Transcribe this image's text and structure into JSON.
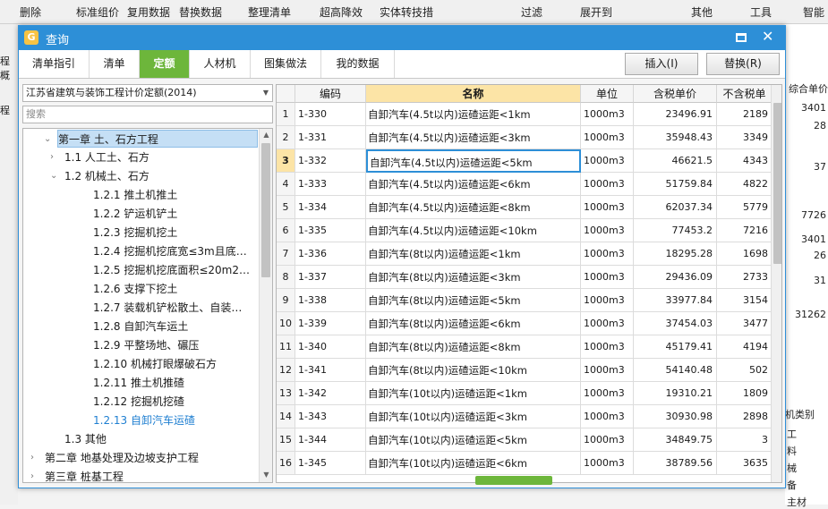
{
  "background_app": {
    "toolbar": [
      "删除",
      "标准组价",
      "复用数据",
      "替换数据",
      "整理清单",
      "超高降效",
      "实体转技措",
      "过滤",
      "展开到",
      "其他",
      "工具",
      "智能"
    ],
    "left_labels": [
      "程概",
      "程"
    ],
    "right_header": "综合单价",
    "right_values": [
      "3401",
      "28",
      "37",
      "7726",
      "3401",
      "26",
      "31",
      "31262"
    ],
    "right_category_header": "机类别",
    "right_categories": [
      "工",
      "料",
      "械",
      "备",
      "主材"
    ]
  },
  "dialog": {
    "title": "查询",
    "tabs": [
      "清单指引",
      "清单",
      "定额",
      "人材机",
      "图集做法",
      "我的数据"
    ],
    "active_tab": "定额",
    "insert_button": "插入(I)",
    "replace_button": "替换(R)"
  },
  "left_panel": {
    "quota_library": "江苏省建筑与装饰工程计价定额(2014)",
    "search_placeholder": "搜索",
    "tree": [
      {
        "label": "第一章 土、石方工程",
        "level": 0,
        "arrow": "down",
        "selected": true
      },
      {
        "label": "1.1 人工土、石方",
        "level": 1,
        "arrow": "right"
      },
      {
        "label": "1.2 机械土、石方",
        "level": 1,
        "arrow": "down"
      },
      {
        "label": "1.2.1 推土机推土",
        "level": 2
      },
      {
        "label": "1.2.2 铲运机铲土",
        "level": 2
      },
      {
        "label": "1.2.3 挖掘机挖土",
        "level": 2
      },
      {
        "label": "1.2.4 挖掘机挖底宽≤3m且底…",
        "level": 2
      },
      {
        "label": "1.2.5 挖掘机挖底面积≤20m2…",
        "level": 2
      },
      {
        "label": "1.2.6 支撑下挖土",
        "level": 2
      },
      {
        "label": "1.2.7 装载机铲松散土、自装…",
        "level": 2
      },
      {
        "label": "1.2.8 自卸汽车运土",
        "level": 2
      },
      {
        "label": "1.2.9 平整场地、碾压",
        "level": 2
      },
      {
        "label": "1.2.10 机械打眼爆破石方",
        "level": 2
      },
      {
        "label": "1.2.11 推土机推碴",
        "level": 2
      },
      {
        "label": "1.2.12 挖掘机挖碴",
        "level": 2
      },
      {
        "label": "1.2.13 自卸汽车运碴",
        "level": 2,
        "current": true
      },
      {
        "label": "1.3 其他",
        "level": 1
      },
      {
        "label": "第二章 地基处理及边坡支护工程",
        "level": 0,
        "arrow": "right"
      },
      {
        "label": "第三章 桩基工程",
        "level": 0,
        "arrow": "right"
      }
    ]
  },
  "grid": {
    "columns": [
      "编码",
      "名称",
      "单位",
      "含税单价",
      "不含税单"
    ],
    "selected_row": 3,
    "rows": [
      {
        "n": "1",
        "code": "1-330",
        "name": "自卸汽车(4.5t以内)运碴运距<1km",
        "unit": "1000m3",
        "tax": "23496.91",
        "notax": "2189"
      },
      {
        "n": "2",
        "code": "1-331",
        "name": "自卸汽车(4.5t以内)运碴运距<3km",
        "unit": "1000m3",
        "tax": "35948.43",
        "notax": "3349"
      },
      {
        "n": "3",
        "code": "1-332",
        "name": "自卸汽车(4.5t以内)运碴运距<5km",
        "unit": "1000m3",
        "tax": "46621.5",
        "notax": "4343"
      },
      {
        "n": "4",
        "code": "1-333",
        "name": "自卸汽车(4.5t以内)运碴运距<6km",
        "unit": "1000m3",
        "tax": "51759.84",
        "notax": "4822"
      },
      {
        "n": "5",
        "code": "1-334",
        "name": "自卸汽车(4.5t以内)运碴运距<8km",
        "unit": "1000m3",
        "tax": "62037.34",
        "notax": "5779"
      },
      {
        "n": "6",
        "code": "1-335",
        "name": "自卸汽车(4.5t以内)运碴运距<10km",
        "unit": "1000m3",
        "tax": "77453.2",
        "notax": "7216"
      },
      {
        "n": "7",
        "code": "1-336",
        "name": "自卸汽车(8t以内)运碴运距<1km",
        "unit": "1000m3",
        "tax": "18295.28",
        "notax": "1698"
      },
      {
        "n": "8",
        "code": "1-337",
        "name": "自卸汽车(8t以内)运碴运距<3km",
        "unit": "1000m3",
        "tax": "29436.09",
        "notax": "2733"
      },
      {
        "n": "9",
        "code": "1-338",
        "name": "自卸汽车(8t以内)运碴运距<5km",
        "unit": "1000m3",
        "tax": "33977.84",
        "notax": "3154"
      },
      {
        "n": "10",
        "code": "1-339",
        "name": "自卸汽车(8t以内)运碴运距<6km",
        "unit": "1000m3",
        "tax": "37454.03",
        "notax": "3477"
      },
      {
        "n": "11",
        "code": "1-340",
        "name": "自卸汽车(8t以内)运碴运距<8km",
        "unit": "1000m3",
        "tax": "45179.41",
        "notax": "4194"
      },
      {
        "n": "12",
        "code": "1-341",
        "name": "自卸汽车(8t以内)运碴运距<10km",
        "unit": "1000m3",
        "tax": "54140.48",
        "notax": "502"
      },
      {
        "n": "13",
        "code": "1-342",
        "name": "自卸汽车(10t以内)运碴运距<1km",
        "unit": "1000m3",
        "tax": "19310.21",
        "notax": "1809"
      },
      {
        "n": "14",
        "code": "1-343",
        "name": "自卸汽车(10t以内)运碴运距<3km",
        "unit": "1000m3",
        "tax": "30930.98",
        "notax": "2898"
      },
      {
        "n": "15",
        "code": "1-344",
        "name": "自卸汽车(10t以内)运碴运距<5km",
        "unit": "1000m3",
        "tax": "34849.75",
        "notax": "3"
      },
      {
        "n": "16",
        "code": "1-345",
        "name": "自卸汽车(10t以内)运碴运距<6km",
        "unit": "1000m3",
        "tax": "38789.56",
        "notax": "3635"
      }
    ]
  }
}
